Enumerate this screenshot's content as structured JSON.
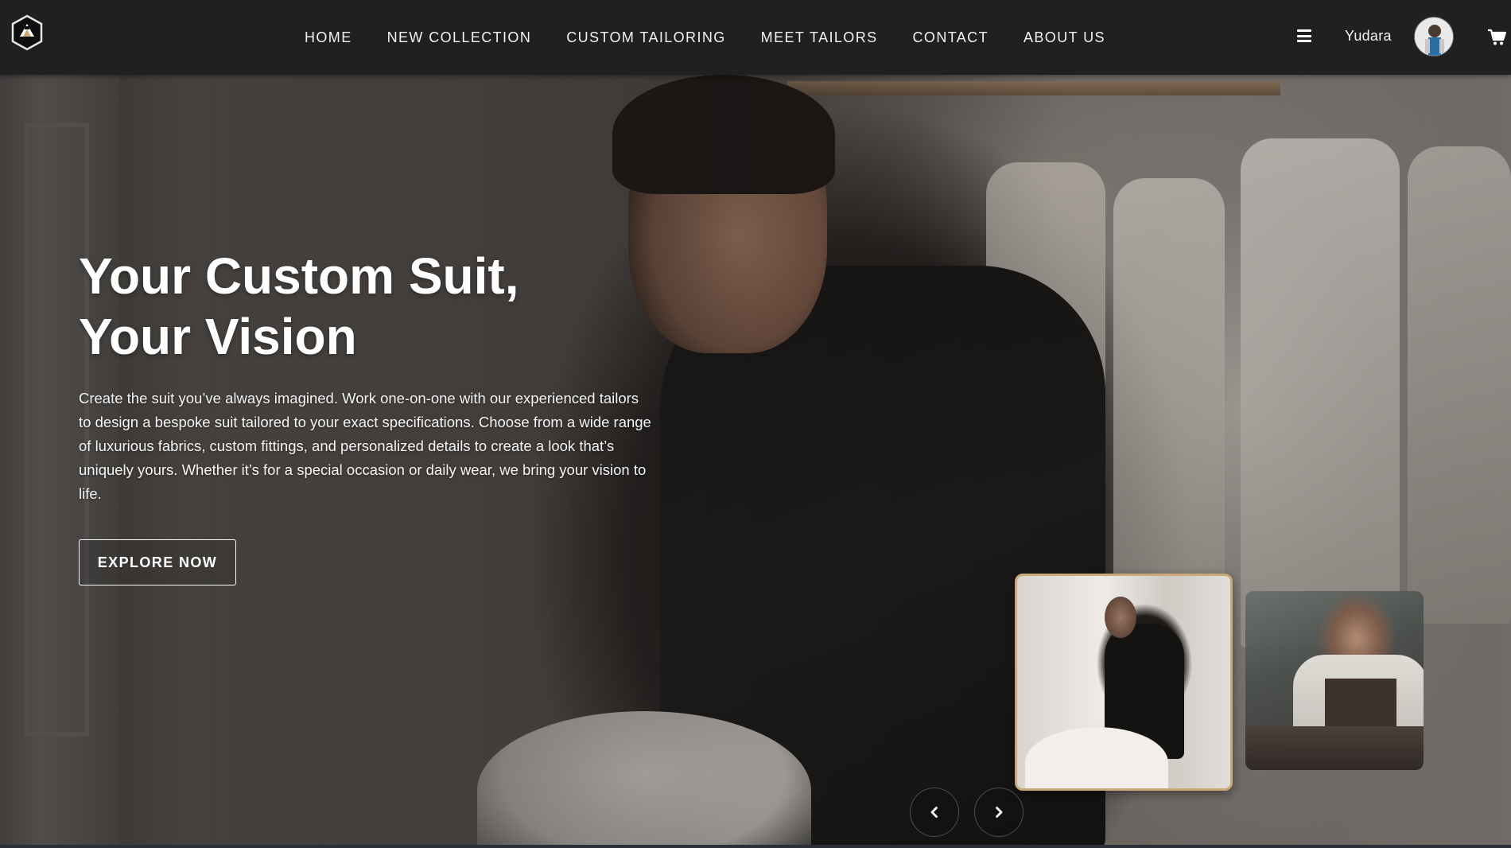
{
  "nav": {
    "links": [
      {
        "label": "HOME"
      },
      {
        "label": "NEW COLLECTION"
      },
      {
        "label": "CUSTOM TAILORING"
      },
      {
        "label": "MEET TAILORS"
      },
      {
        "label": "CONTACT"
      },
      {
        "label": "ABOUT US"
      }
    ],
    "username": "Yudara",
    "icons": {
      "logo": "brand-logo-icon",
      "menu": "hamburger-menu-icon",
      "cart": "shopping-cart-icon"
    }
  },
  "hero": {
    "title_line1": "Your Custom Suit,",
    "title_line2": "Your Vision",
    "description": "Create the suit you’ve always imagined. Work one-on-one with our experienced tailors to design a bespoke suit tailored to your exact specifications. Choose from a wide range of luxurious fabrics, custom fittings, and personalized details to create a look that’s uniquely yours. Whether it’s for a special occasion or daily wear, we bring your vision to life.",
    "cta_label": "EXPLORE NOW"
  },
  "carousel": {
    "active_index": 0,
    "prev_icon": "chevron-left-icon",
    "next_icon": "chevron-right-icon",
    "accent_color": "#c9a979"
  },
  "colors": {
    "navbar_bg": "#1f2022",
    "text": "#ffffff"
  }
}
